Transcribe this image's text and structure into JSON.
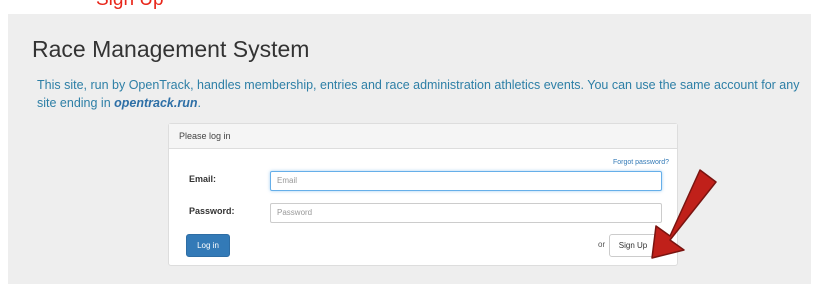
{
  "annotation": {
    "label": "Sign Up",
    "label_color": "#e8261a",
    "bullet_color": "#b7e04a",
    "arrow_color": "#c0201a"
  },
  "page": {
    "title": "Race Management System",
    "intro": {
      "part1": "This site, run by ",
      "link": "OpenTrack",
      "part2": ", handles membership, entries and race administration athletics events. You can use the same account for any site ending in ",
      "domain": "opentrack.run",
      "part3": "."
    }
  },
  "login": {
    "header": "Please log in",
    "forgot_password": "Forgot password?",
    "email_label": "Email:",
    "email_placeholder": "Email",
    "password_label": "Password:",
    "password_placeholder": "Password",
    "login_button": "Log in",
    "or_text": "or",
    "signup_button": "Sign Up"
  },
  "colors": {
    "primary": "#337ab7",
    "link": "#2d7fa6"
  }
}
